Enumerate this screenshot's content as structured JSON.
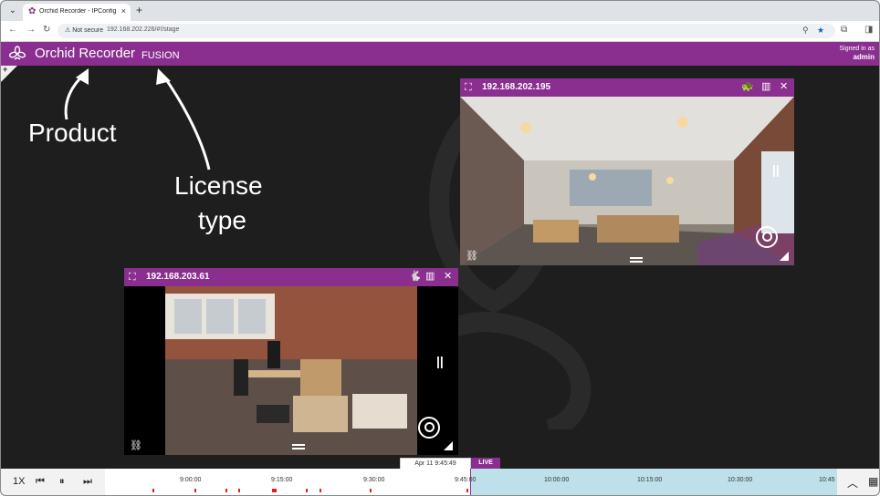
{
  "browser": {
    "tab_title": "Orchid Recorder - IPConfigure",
    "tab_close": "×",
    "new_tab": "+",
    "not_secure": "Not secure",
    "url": "192.168.202.226/#!/stage"
  },
  "app": {
    "product": "Orchid Recorder",
    "license": "FUSION",
    "signed_in_label": "Signed in as",
    "user": "admin",
    "add": "+"
  },
  "annotations": {
    "product": "Product",
    "license_type_line1": "License",
    "license_type_line2": "type"
  },
  "cameras": [
    {
      "ip": "192.168.202.195"
    },
    {
      "ip": "192.168.203.61"
    }
  ],
  "timeline": {
    "speed": "1X",
    "ticks": [
      "9:00:00",
      "9:15:00",
      "9:30:00",
      "9:45:00",
      "10:00:00",
      "10:15:00",
      "10:30:00",
      "10:45"
    ],
    "current": "Apr 11 9:45:49",
    "live": "LIVE"
  },
  "colors": {
    "brand": "#8a2f8f",
    "stage": "#1e1e1e",
    "future": "#bde0ea",
    "recording": "#e02020"
  }
}
